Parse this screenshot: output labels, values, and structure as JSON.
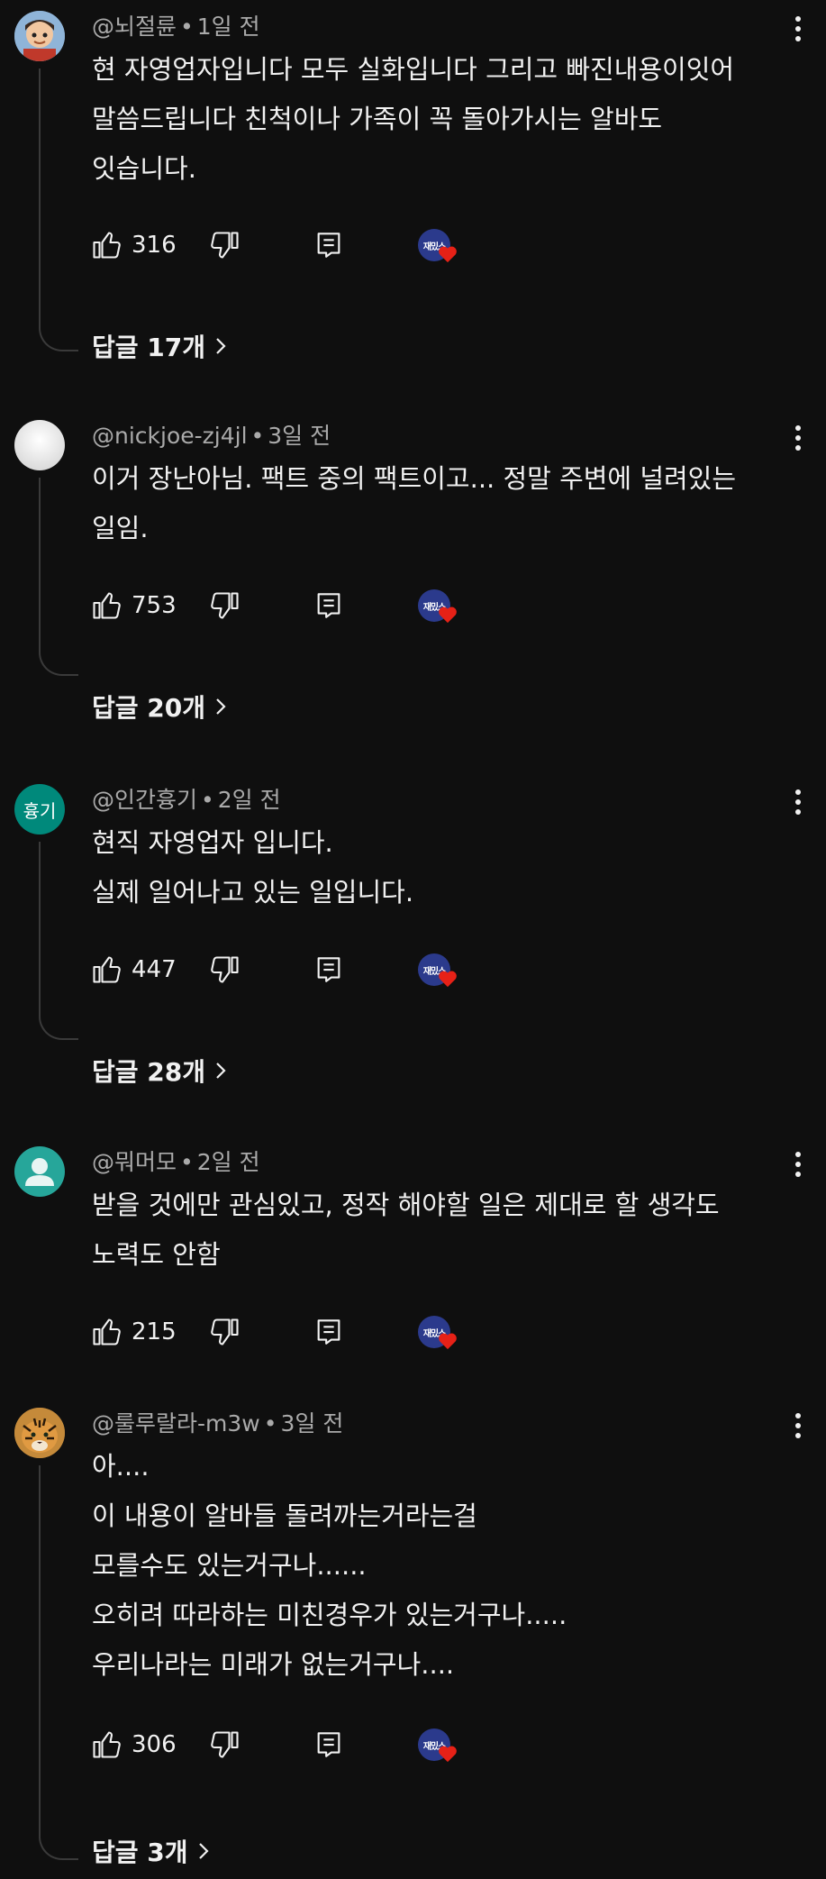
{
  "comments": [
    {
      "author": "@뇌절륜",
      "time": "1일 전",
      "lines": [
        "현 자영업자입니다 모두 실화입니다 그리고 빠진내용이잇어",
        "말씀드립니다 친척이나 가족이 꼭 돌아가시는 알바도",
        "잇습니다."
      ],
      "likes": "316",
      "replies": "답글 17개",
      "avatar": "cartoon-character"
    },
    {
      "author": "@nickjoe-zj4jl",
      "time": "3일 전",
      "lines": [
        "이거 장난아님. 팩트 중의 팩트이고... 정말 주변에 널려있는",
        "일임."
      ],
      "likes": "753",
      "replies": "답글 20개",
      "avatar": "white-gradient"
    },
    {
      "author": "@인간흉기",
      "time": "2일 전",
      "lines": [
        "현직 자영업자 입니다.",
        "실제 일어나고 있는 일입니다."
      ],
      "likes": "447",
      "replies": "답글 28개",
      "avatar_text": "흉기",
      "avatar_color": "#00897b"
    },
    {
      "author": "@뭐머모",
      "time": "2일 전",
      "lines": [
        "받을 것에만 관심있고, 정작 해야할 일은 제대로 할 생각도",
        "노력도 안함"
      ],
      "likes": "215",
      "avatar_color": "#26a69a"
    },
    {
      "author": "@룰루랄라-m3w",
      "time": "3일 전",
      "lines": [
        "아....",
        "이 내용이 알바들 돌려까는거라는걸",
        "모를수도 있는거구나......",
        "오히려 따라하는 미친경우가 있는거구나.....",
        "우리나라는 미래가 없는거구나...."
      ],
      "likes": "306",
      "replies": "답글 3개",
      "avatar": "tiger-photo"
    }
  ],
  "creator_badge": "재밌스",
  "icons": {
    "like": "thumbs-up-icon",
    "dislike": "thumbs-down-icon",
    "reply": "reply-icon",
    "more": "more-vertical-icon",
    "heart": "heart-icon",
    "chevron": "chevron-right-icon"
  },
  "colors": {
    "background": "#0f0f0f",
    "text": "#f1f1f1",
    "meta": "#aaaaaa",
    "heart": "#e62117",
    "badge": "#2b3a8c"
  }
}
